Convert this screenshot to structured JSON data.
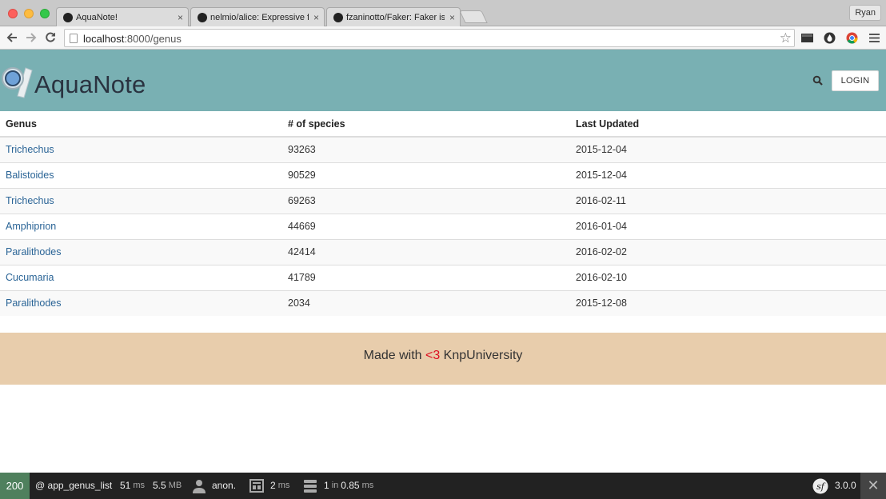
{
  "browser": {
    "tabs": [
      {
        "title": "AquaNote!",
        "active": true
      },
      {
        "title": "nelmio/alice: Expressive fix",
        "active": false
      },
      {
        "title": "fzaninotto/Faker: Faker is a",
        "active": false
      }
    ],
    "tab_close_glyph": "×",
    "profile_name": "Ryan",
    "url_host": "localhost",
    "url_path": ":8000/genus"
  },
  "header": {
    "brand": "AquaNote",
    "login_label": "LOGIN"
  },
  "table": {
    "headers": [
      "Genus",
      "# of species",
      "Last Updated"
    ],
    "rows": [
      {
        "genus": "Trichechus",
        "species": "93263",
        "updated": "2015-12-04"
      },
      {
        "genus": "Balistoides",
        "species": "90529",
        "updated": "2015-12-04"
      },
      {
        "genus": "Trichechus",
        "species": "69263",
        "updated": "2016-02-11"
      },
      {
        "genus": "Amphiprion",
        "species": "44669",
        "updated": "2016-01-04"
      },
      {
        "genus": "Paralithodes",
        "species": "42414",
        "updated": "2016-02-02"
      },
      {
        "genus": "Cucumaria",
        "species": "41789",
        "updated": "2016-02-10"
      },
      {
        "genus": "Paralithodes",
        "species": "2034",
        "updated": "2015-12-08"
      }
    ]
  },
  "footer": {
    "prefix": "Made with ",
    "heart": "<3",
    "suffix": " KnpUniversity"
  },
  "profiler": {
    "status_code": "200",
    "route": "@ app_genus_list",
    "time_value": "51",
    "time_unit": "ms",
    "memory_value": "5.5",
    "memory_unit": "MB",
    "user": "anon.",
    "twig_value": "2",
    "twig_unit": "ms",
    "db_queries": "1",
    "db_in": "in",
    "db_time": "0.85",
    "db_unit": "ms",
    "version": "3.0.0",
    "close_glyph": "✕"
  },
  "colors": {
    "header_bg": "#79b0b3",
    "footer_bg": "#e8cdac",
    "link": "#2a6496",
    "heart": "#dd1122",
    "status_ok": "#4f805d"
  }
}
